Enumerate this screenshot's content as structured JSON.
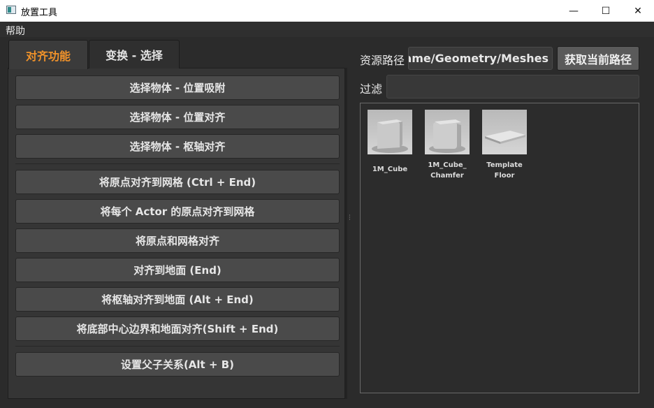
{
  "window": {
    "title": "放置工具"
  },
  "window_controls": {
    "minimize": "—",
    "maximize": "☐",
    "close": "✕"
  },
  "menu": {
    "help": "帮助"
  },
  "tabs": [
    {
      "label": "对齐功能"
    },
    {
      "label": "变换 - 选择"
    }
  ],
  "align_buttons": [
    "选择物体 - 位置吸附",
    "选择物体 - 位置对齐",
    "选择物体 - 枢轴对齐",
    "将原点对齐到网格 (Ctrl + End)",
    "将每个 Actor 的原点对齐到网格",
    "将原点和网格对齐",
    "对齐到地面 (End)",
    "将枢轴对齐到地面 (Alt + End)",
    "将底部中心边界和地面对齐(Shift + End)",
    "设置父子关系(Alt + B)"
  ],
  "right_panel": {
    "path_label": "资源路径",
    "path_value": "/Game/Geometry/Meshes",
    "get_path_button": "获取当前路径",
    "filter_label": "过滤",
    "filter_value": ""
  },
  "assets": [
    {
      "name": "1M_Cube",
      "icon": "cube-icon"
    },
    {
      "name": "1M_Cube_\nChamfer",
      "icon": "chamfered-cube-icon"
    },
    {
      "name": "Template\nFloor",
      "icon": "floor-plane-icon"
    }
  ],
  "colors": {
    "accent": "#f0922a",
    "background": "#2b2b2b",
    "button": "#4a4a4a"
  }
}
